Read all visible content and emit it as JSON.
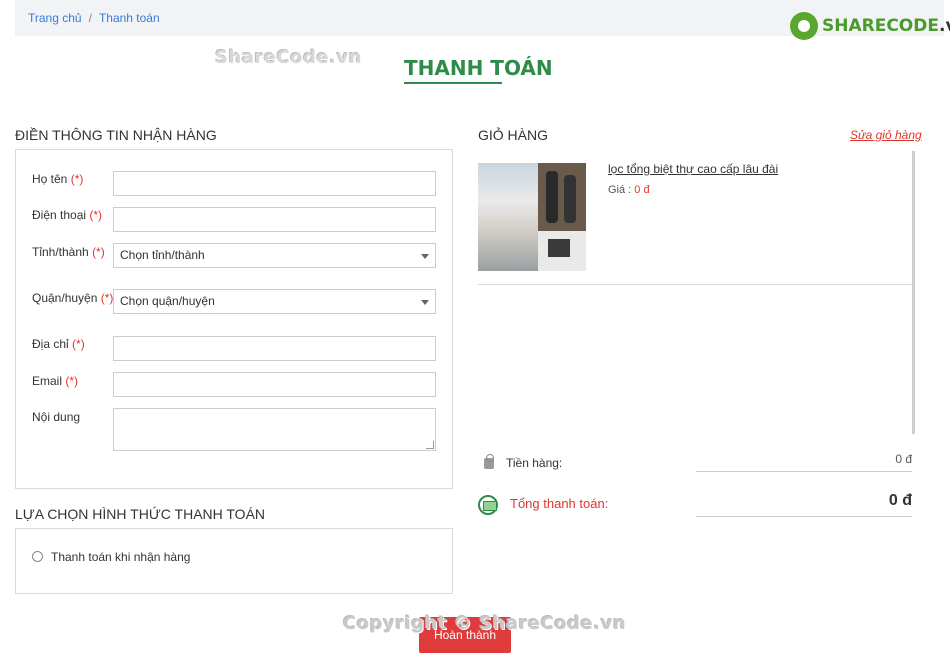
{
  "breadcrumb": {
    "home": "Trang chủ",
    "separator": "/",
    "current": "Thanh toán"
  },
  "watermarks": {
    "top": "ShareCode.vn",
    "bottom": "Copyright © ShareCode.vn"
  },
  "logo": {
    "brand_green": "SHARECODE",
    "brand_dark": ".vn",
    "color": "#4a9b2a"
  },
  "page": {
    "title": "THANH TOÁN",
    "accent_color": "#2e8b4a"
  },
  "shipping_form": {
    "title": "ĐIỀN THÔNG TIN NHẬN HÀNG",
    "required_mark": "(*)",
    "fields": {
      "name": {
        "label": "Họ tên",
        "value": ""
      },
      "phone": {
        "label": "Điện thoại",
        "value": ""
      },
      "province": {
        "label": "Tỉnh/thành",
        "selected": "Chọn tỉnh/thành"
      },
      "district": {
        "label": "Quận/huyện",
        "selected": "Chọn quận/huyện"
      },
      "address": {
        "label": "Địa chỉ",
        "value": ""
      },
      "email": {
        "label": "Email",
        "value": ""
      },
      "note": {
        "label": "Nội dung",
        "value": ""
      }
    }
  },
  "payment": {
    "title": "LỰA CHỌN HÌNH THỨC THANH TOÁN",
    "options": [
      {
        "label": "Thanh toán khi nhận hàng",
        "checked": false
      }
    ]
  },
  "cart": {
    "title": "GIỎ HÀNG",
    "edit_link": "Sửa giỏ hàng",
    "items": [
      {
        "name": "lọc tổng biệt thự cao cấp lâu đài",
        "price_label": "Giá :",
        "price": "0 đ"
      }
    ],
    "subtotal_label": "Tiền hàng:",
    "subtotal_value": "0 đ",
    "total_label": "Tổng thanh toán:",
    "total_value": "0 đ"
  },
  "actions": {
    "finish_label": "Hoàn thành",
    "finish_color": "#e03b3b"
  }
}
